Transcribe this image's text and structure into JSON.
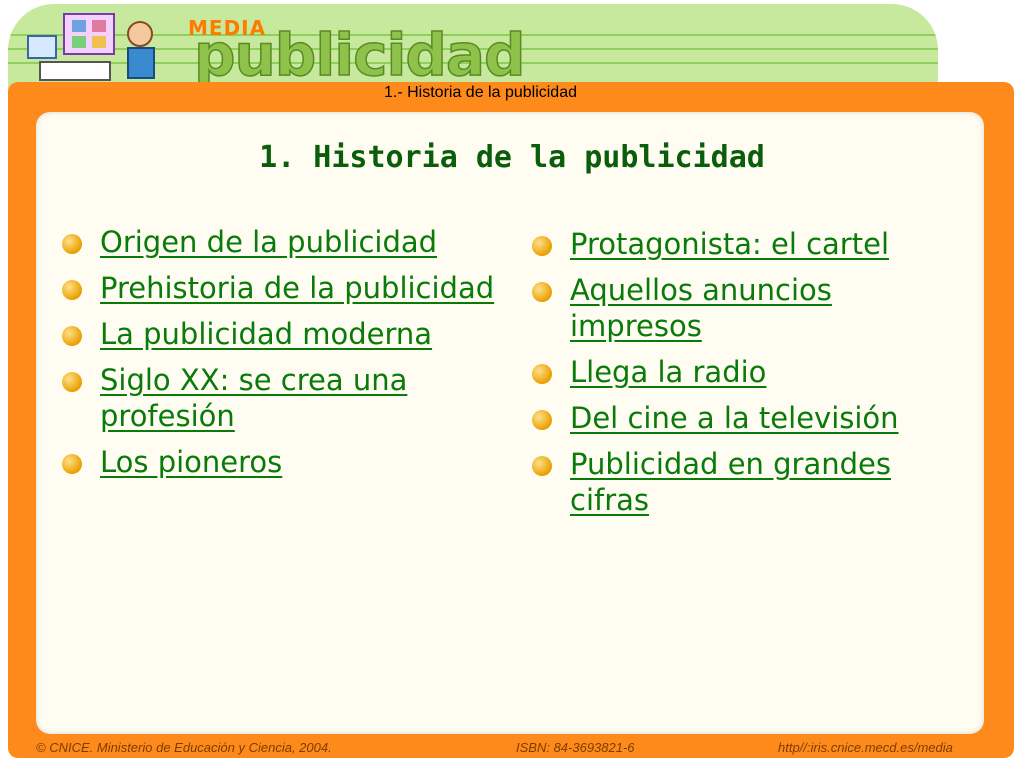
{
  "header": {
    "logo_top": "MEDIA",
    "logo_main": "publicidad",
    "breadcrumb": "1.- Historia de la  publicidad"
  },
  "page": {
    "title": "1. Historia de la publicidad"
  },
  "left_links": [
    {
      "label": "Origen de la publicidad"
    },
    {
      "label": "Prehistoria de la publicidad"
    },
    {
      "label": "La publicidad moderna"
    },
    {
      "label": "Siglo XX: se crea una profesión"
    },
    {
      "label": "Los pioneros"
    }
  ],
  "right_links": [
    {
      "label": "Protagonista: el cartel"
    },
    {
      "label": "Aquellos anuncios impresos"
    },
    {
      "label": "Llega la radio"
    },
    {
      "label": "Del cine a la televisión"
    },
    {
      "label": "Publicidad en grandes cifras"
    }
  ],
  "footer": {
    "copyright": "© CNICE. Ministerio de Educación y Ciencia, 2004.",
    "isbn": "ISBN: 84-3693821-6",
    "url": "http//:iris.cnice.mecd.es/media"
  },
  "colors": {
    "frame": "#ff8a1c",
    "link": "#0a7a0a",
    "title": "#0a5d0a",
    "bullet": "#e9a000",
    "header_band": "#c7e99e"
  }
}
